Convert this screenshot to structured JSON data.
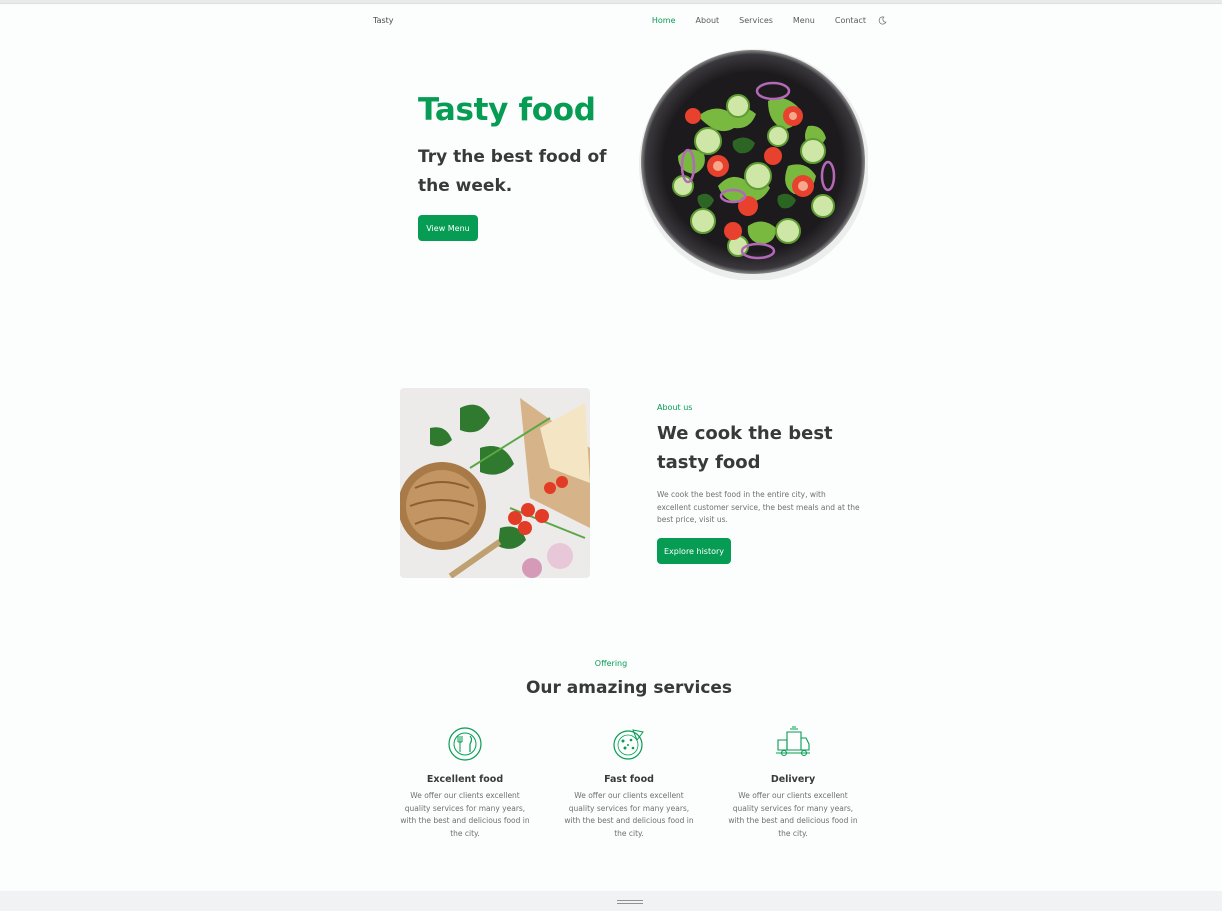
{
  "nav": {
    "logo": "Tasty",
    "links": [
      "Home",
      "About",
      "Services",
      "Menu",
      "Contact"
    ],
    "active": "Home"
  },
  "hero": {
    "title": "Tasty food",
    "subtitle": "Try the best food of the week.",
    "button": "View Menu"
  },
  "about": {
    "label": "About us",
    "title": "We cook the best tasty food",
    "description": "We cook the best food in the entire city, with excellent customer service, the best meals and at the best price, visit us.",
    "button": "Explore history"
  },
  "services": {
    "label": "Offering",
    "title": "Our amazing services",
    "items": [
      {
        "name": "Excellent food",
        "description": "We offer our clients excellent quality services for many years, with the best and delicious food in the city.",
        "icon": "plate-cutlery-icon"
      },
      {
        "name": "Fast food",
        "description": "We offer our clients excellent quality services for many years, with the best and delicious food in the city.",
        "icon": "pizza-icon"
      },
      {
        "name": "Delivery",
        "description": "We offer our clients excellent quality services for many years, with the best and delicious food in the city.",
        "icon": "delivery-truck-icon"
      }
    ]
  },
  "colors": {
    "accent": "#069c54",
    "text": "#393939",
    "background": "#fbfefd"
  }
}
